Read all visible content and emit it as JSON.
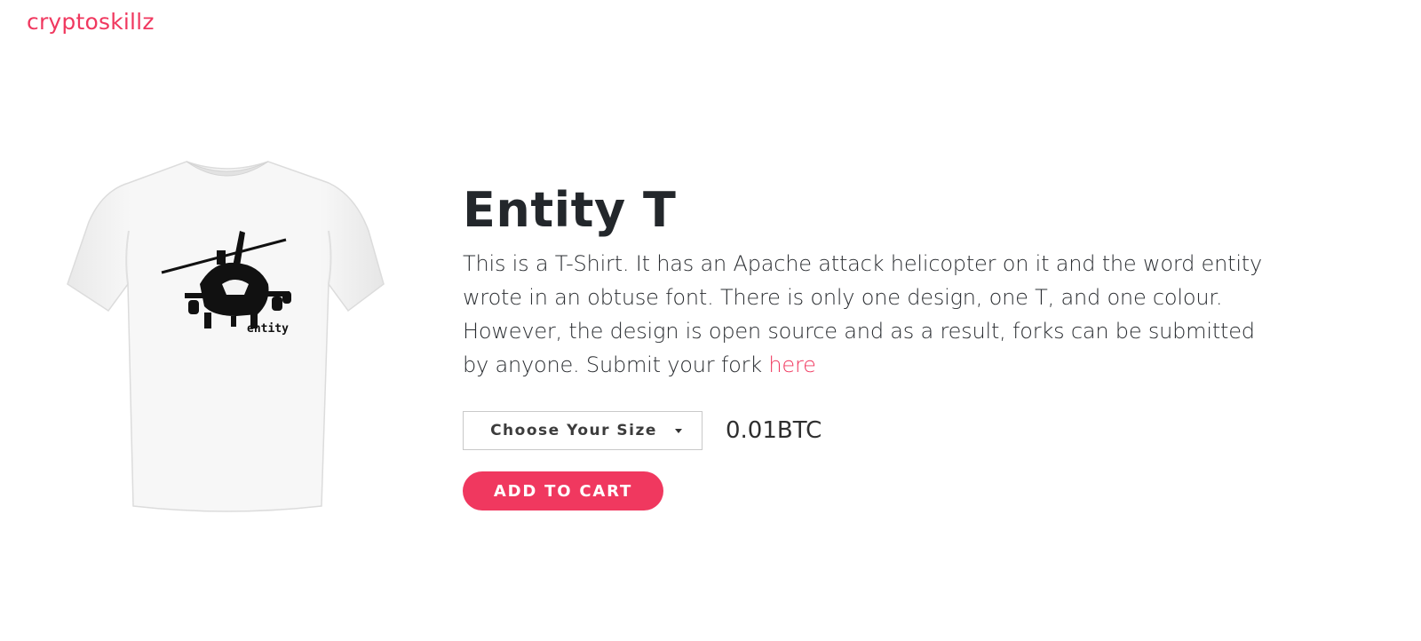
{
  "header": {
    "brand": "cryptoskillz"
  },
  "product": {
    "title": "Entity T",
    "description": "This is a T-Shirt. It has an Apache attack helicopter on it and the word entity wrote in an obtuse font. There is only one design, one T, and one colour. However, the design is open source and as a result, forks can be submitted by anyone. Submit your fork ",
    "description_link": "here",
    "shirt_print_text": "entity",
    "size_select": {
      "selected": "Choose Your Size"
    },
    "price": "0.01BTC",
    "add_to_cart_label": "ADD TO CART"
  },
  "colors": {
    "accent": "#f0385f",
    "text": "#23272b",
    "border": "#c9c9c9"
  },
  "icons": {
    "dropdown": "chevron-down-icon"
  }
}
